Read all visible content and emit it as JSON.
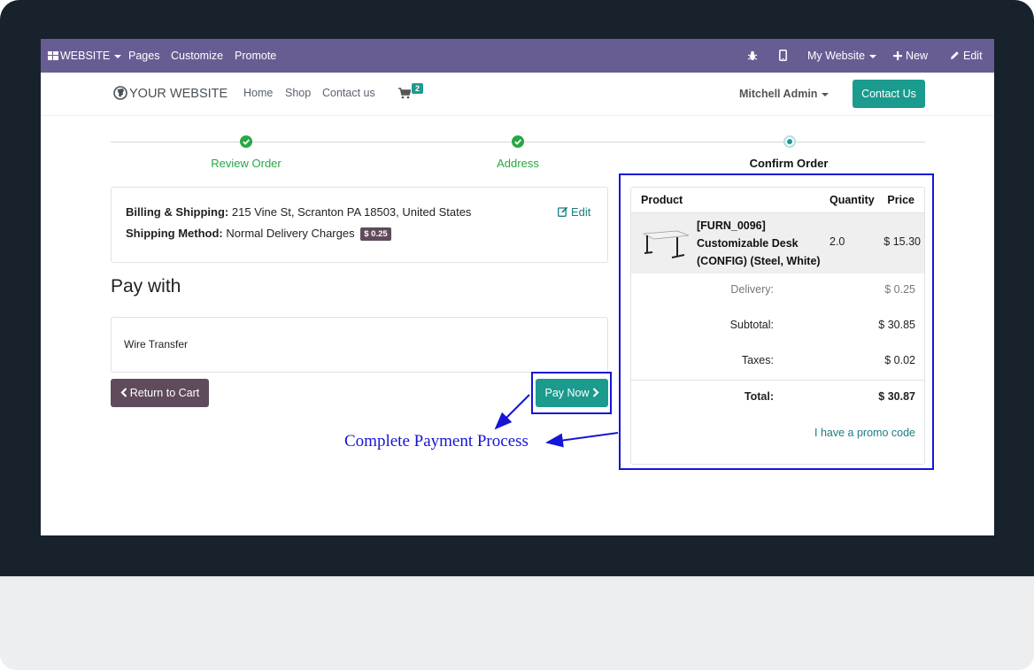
{
  "admin_bar": {
    "website_menu": "WEBSITE",
    "pages": "Pages",
    "customize": "Customize",
    "promote": "Promote",
    "my_website": "My Website",
    "new": "New",
    "edit": "Edit"
  },
  "site_header": {
    "logo_text": "YOUR WEBSITE",
    "nav": [
      "Home",
      "Shop",
      "Contact us"
    ],
    "cart_count": "2",
    "user": "Mitchell Admin",
    "contact_button": "Contact Us"
  },
  "progress": {
    "steps": [
      {
        "label": "Review Order",
        "state": "done"
      },
      {
        "label": "Address",
        "state": "done"
      },
      {
        "label": "Confirm Order",
        "state": "current"
      }
    ]
  },
  "address_card": {
    "billing_label": "Billing & Shipping:",
    "billing_value": "215 Vine St, Scranton PA 18503, United States",
    "method_label": "Shipping Method:",
    "method_value": "Normal Delivery Charges",
    "method_price": "$ 0.25",
    "edit": "Edit"
  },
  "payment": {
    "title": "Pay with",
    "option": "Wire Transfer",
    "return_button": "Return to Cart",
    "pay_button": "Pay Now"
  },
  "summary": {
    "headers": {
      "product": "Product",
      "quantity": "Quantity",
      "price": "Price"
    },
    "product": {
      "name_line1": "[FURN_0096]",
      "name_line2": "Customizable Desk",
      "name_line3": "(CONFIG) (Steel, White)",
      "quantity": "2.0",
      "price": "$ 15.30"
    },
    "delivery_label": "Delivery:",
    "delivery_value": "$ 0.25",
    "subtotal_label": "Subtotal:",
    "subtotal_value": "$ 30.85",
    "taxes_label": "Taxes:",
    "taxes_value": "$ 0.02",
    "total_label": "Total:",
    "total_value": "$ 30.87",
    "promo": "I have a promo code"
  },
  "annotation": {
    "text": "Complete Payment Process",
    "color": "#1515d8"
  },
  "colors": {
    "admin_bar": "#685d93",
    "primary": "#1b9a8e",
    "secondary": "#5f4b5c",
    "success": "#28a745",
    "link": "#1c7d83"
  }
}
